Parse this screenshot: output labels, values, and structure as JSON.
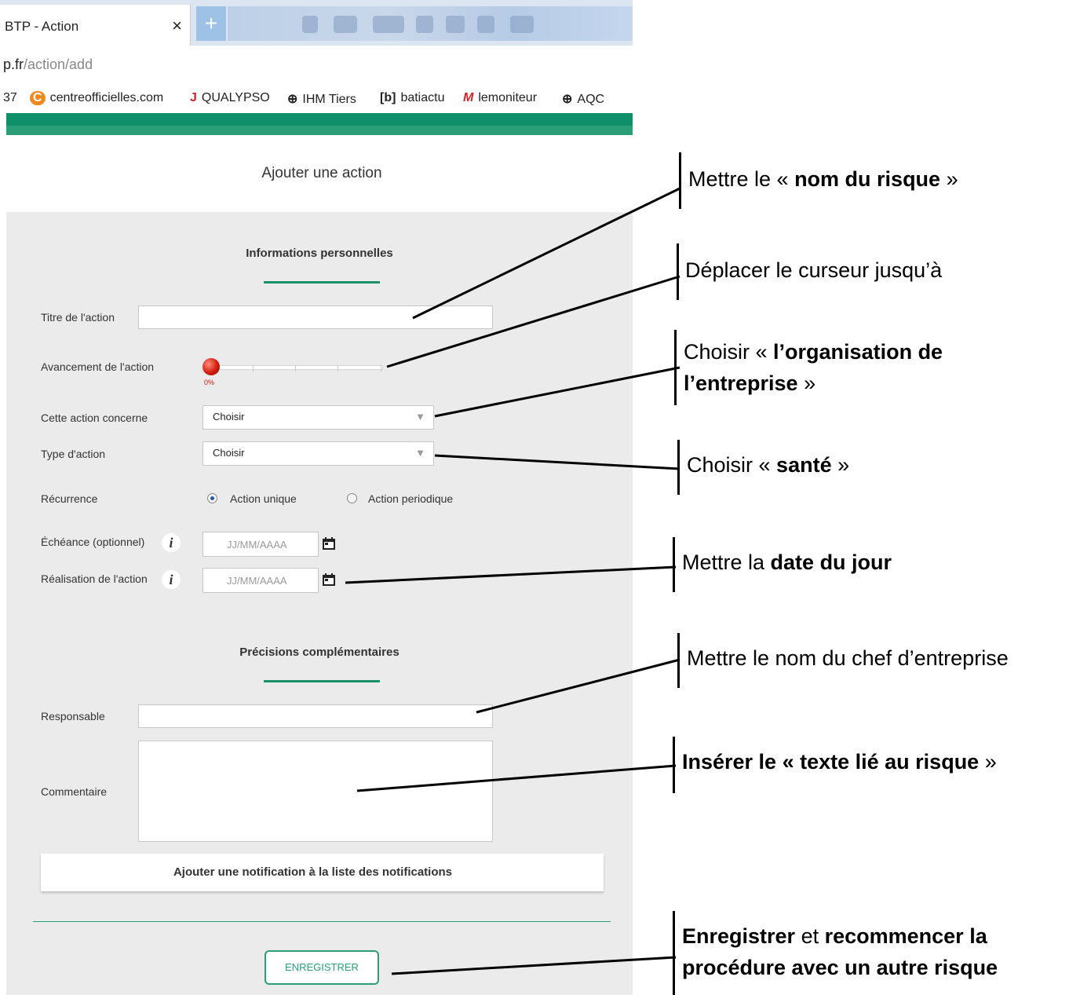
{
  "browser": {
    "tab_title": "BTP - Action",
    "tab_close": "×",
    "new_tab": "+",
    "url_prefix": "p.fr",
    "url_path": "/action/add",
    "bookmarks": [
      {
        "icon": "",
        "label": "37"
      },
      {
        "icon": "C",
        "label": "centreofficielles.com"
      },
      {
        "icon": "J",
        "label": "QUALYPSO"
      },
      {
        "icon": "⊕",
        "label": "IHM Tiers"
      },
      {
        "icon": "[b]",
        "label": "batiactu"
      },
      {
        "icon": "M",
        "label": "lemoniteur"
      },
      {
        "icon": "⊕",
        "label": "AQC"
      }
    ]
  },
  "page": {
    "title": "Ajouter une action",
    "section1": "Informations personnelles",
    "section2": "Précisions complémentaires",
    "fields": {
      "titre": "Titre de l'action",
      "avancement": "Avancement de l'action",
      "avancement_value": "0%",
      "concerne": "Cette action concerne",
      "concerne_value": "Choisir",
      "type": "Type d'action",
      "type_value": "Choisir",
      "recurrence": "Récurrence",
      "radio_unique": "Action unique",
      "radio_periodique": "Action periodique",
      "echeance": "Échéance (optionnel)",
      "realisation": "Réalisation de l'action",
      "date_placeholder": "JJ/MM/AAAA",
      "info": "i",
      "responsable": "Responsable",
      "commentaire": "Commentaire"
    },
    "notification": "Ajouter une notification à la liste des notifications",
    "save": "ENREGISTRER"
  },
  "slider": {
    "progress_percent": 0
  },
  "annotations": {
    "a1": {
      "pre": "Mettre le « ",
      "bold": "nom du risque",
      "post": " »"
    },
    "a2": "Déplacer le curseur jusqu’à",
    "a3": {
      "pre": "Choisir « ",
      "bold1": "l’organisation de",
      "bold2": "l’entreprise",
      "post": " »"
    },
    "a4": {
      "pre": "Choisir « ",
      "bold": "santé",
      "post": " »"
    },
    "a5": {
      "pre": "Mettre la ",
      "bold": "date du jour"
    },
    "a6": "Mettre le nom du chef d’entreprise",
    "a7": {
      "bold1": "Insérer le « ",
      "bold2": "texte lié au risque",
      "post": " »"
    },
    "a8": {
      "bold1": "Enregistrer",
      "mid": " et ",
      "bold2": "recommencer la",
      "bold3": "procédure avec un autre risque"
    }
  },
  "colors": {
    "accent": "#2a9e77",
    "header_green": "#0f8f6a",
    "slider_knob": "#d21b0e"
  }
}
